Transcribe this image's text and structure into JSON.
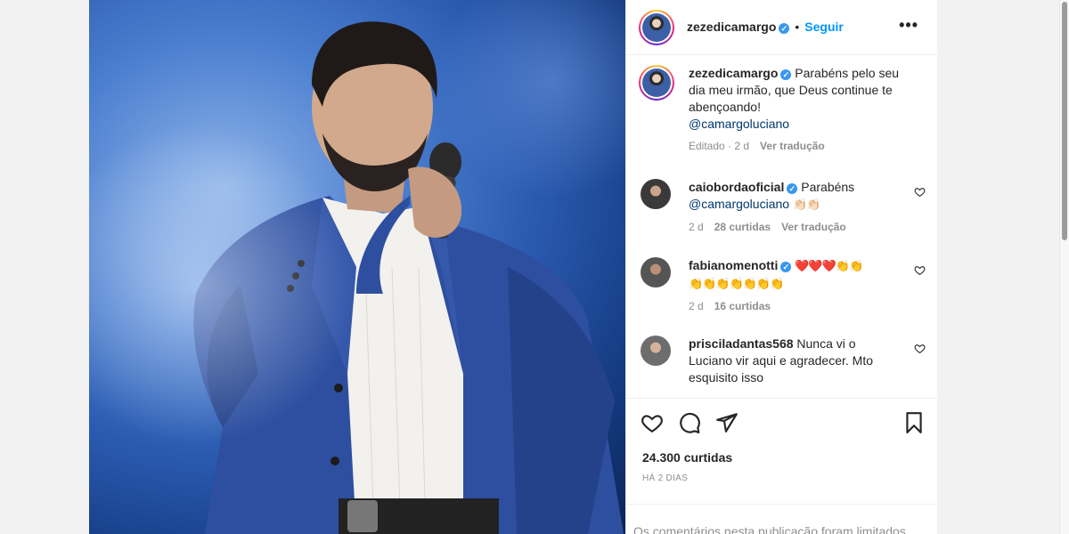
{
  "post": {
    "author": "zezedicamargo",
    "follow_label": "Seguir",
    "separator": "•",
    "more_label": "•••"
  },
  "caption": {
    "author": "zezedicamargo",
    "text": "Parabéns pelo seu dia meu irmão, que Deus continue te abençoando!",
    "mention": "@camargoluciano",
    "edited": "Editado · 2 d",
    "translate": "Ver tradução"
  },
  "comments": [
    {
      "author": "caiobordaoficial",
      "verified": true,
      "text": "Parabéns",
      "mention": "@camargoluciano",
      "emoji": "👏🏻👏🏻",
      "age": "2 d",
      "likes": "28 curtidas",
      "translate": "Ver tradução"
    },
    {
      "author": "fabianomenotti",
      "verified": true,
      "emoji_line1": "❤️❤️❤️👏👏",
      "emoji_line2": "👏👏👏👏👏👏👏",
      "age": "2 d",
      "likes": "16 curtidas"
    },
    {
      "author": "priscila­dantas568",
      "text": "Nunca vi o Luciano vir aqui e agradecer. Mto esquisito isso"
    }
  ],
  "actions": {
    "likes": "24.300 curtidas",
    "when": "HÁ 2 DIAS"
  },
  "footer": {
    "limited_text": "Os comentários nesta publicação foram limitados"
  },
  "colors": {
    "accent": "#0095f6",
    "muted": "#8e8e8e",
    "verified": "#3897f0"
  }
}
